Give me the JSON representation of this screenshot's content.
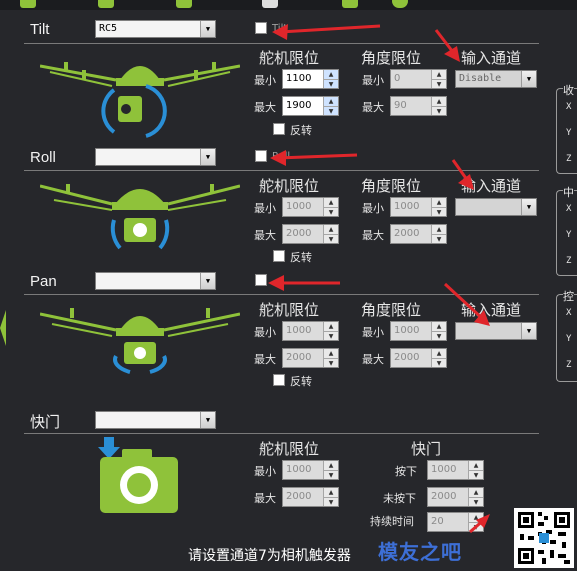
{
  "colors": {
    "accent_green": "#8fc23a",
    "accent_blue": "#2a8fd6",
    "annotation_red": "#e0262b"
  },
  "sections": [
    {
      "label": "Tilt",
      "channel": "RC5",
      "checkbox_label": "Tilt",
      "servo_header": "舵机限位",
      "angle_header": "角度限位",
      "input_header": "输入通道",
      "servo_min_label": "最小",
      "servo_max_label": "最大",
      "servo_min": "1100",
      "servo_max": "1900",
      "angle_min_label": "最小",
      "angle_max_label": "最大",
      "angle_min": "0",
      "angle_max": "90",
      "input_channel": "Disable",
      "reverse_label": "反转"
    },
    {
      "label": "Roll",
      "channel": "",
      "checkbox_label": "Roll",
      "servo_header": "舵机限位",
      "angle_header": "角度限位",
      "input_header": "输入通道",
      "servo_min_label": "最小",
      "servo_max_label": "最大",
      "servo_min": "1000",
      "servo_max": "2000",
      "angle_min_label": "最小",
      "angle_max_label": "最大",
      "angle_min": "1000",
      "angle_max": "2000",
      "input_channel": "",
      "reverse_label": "反转"
    },
    {
      "label": "Pan",
      "channel": "",
      "checkbox_label": "",
      "servo_header": "舵机限位",
      "angle_header": "角度限位",
      "input_header": "输入通道",
      "servo_min_label": "最小",
      "servo_max_label": "最大",
      "servo_min": "1000",
      "servo_max": "2000",
      "angle_min_label": "最小",
      "angle_max_label": "最大",
      "angle_min": "1000",
      "angle_max": "2000",
      "input_channel": "",
      "reverse_label": "反转"
    }
  ],
  "shutter": {
    "label": "快门",
    "channel": "",
    "servo_header": "舵机限位",
    "shutter_header": "快门",
    "servo_min_label": "最小",
    "servo_max_label": "最大",
    "servo_min": "1000",
    "servo_max": "2000",
    "pressed_label": "按下",
    "pressed_value": "1000",
    "released_label": "未按下",
    "released_value": "2000",
    "duration_label": "持续时间",
    "duration_value": "20"
  },
  "side_panels": [
    {
      "title": "收",
      "axes": [
        "X",
        "Y",
        "Z"
      ]
    },
    {
      "title": "中",
      "axes": [
        "X",
        "Y",
        "Z"
      ]
    },
    {
      "title": "控",
      "axes": [
        "X",
        "Y",
        "Z"
      ]
    }
  ],
  "caption": "请设置通道7为相机触发器",
  "watermark": "模友之吧",
  "icons": [
    "tilt-drone-icon",
    "roll-drone-icon",
    "pan-drone-icon",
    "shutter-camera-icon",
    "qr-code-icon",
    "red-arrow-icon"
  ]
}
